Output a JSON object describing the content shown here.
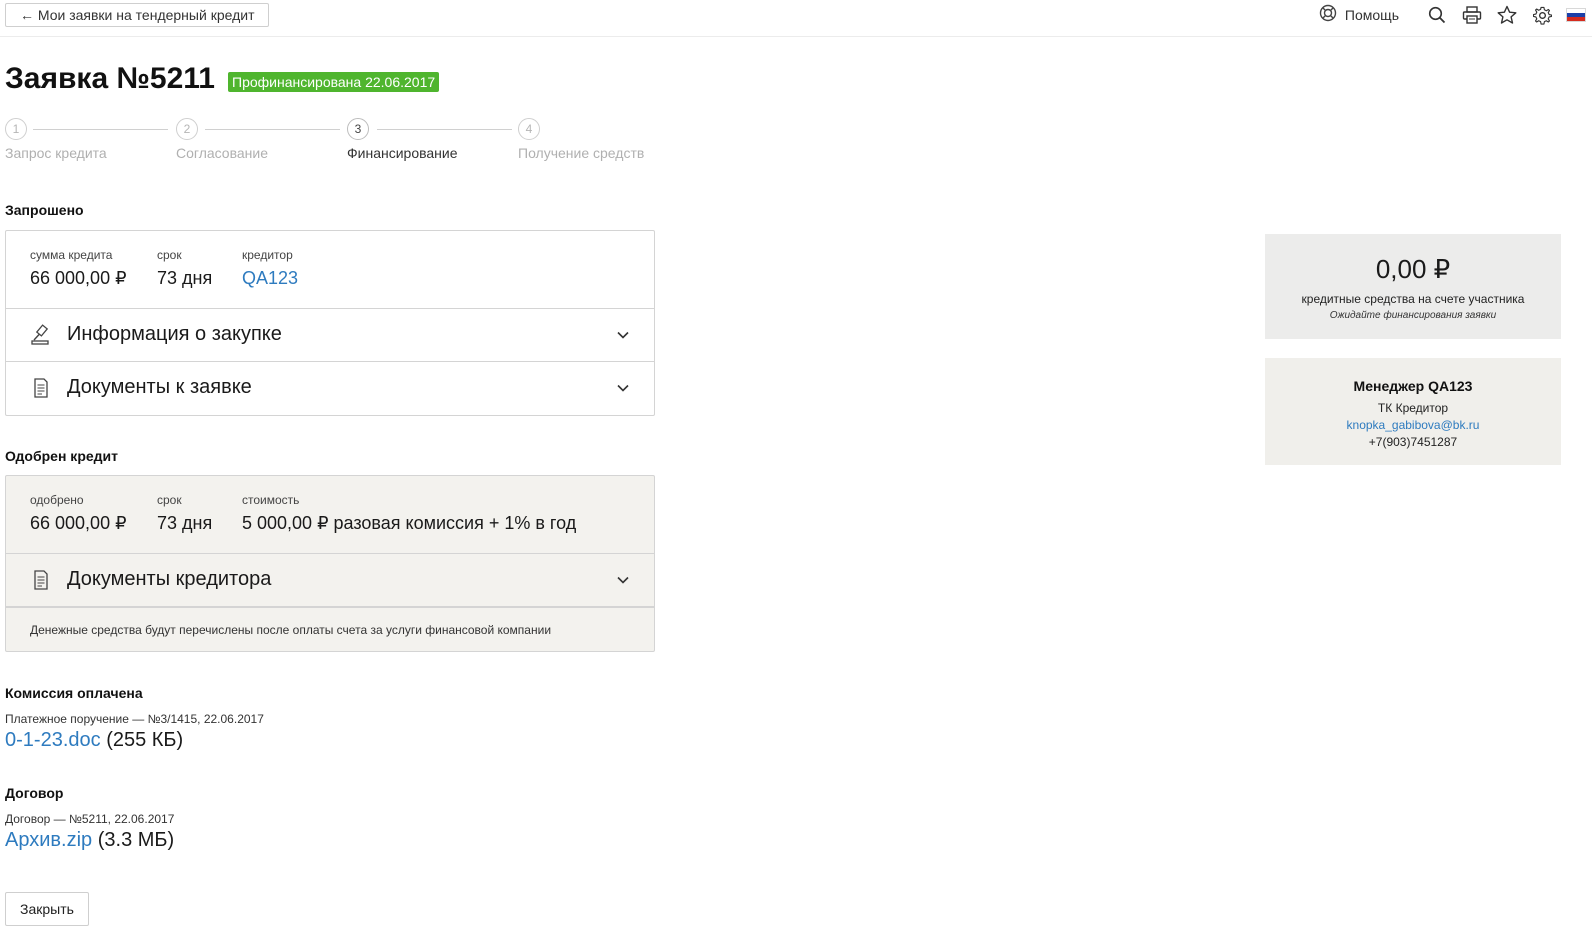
{
  "header": {
    "back_label": "← Мои заявки на тендерный кредит",
    "help_label": "Помощь",
    "icons": [
      "lifebuoy-icon",
      "search-icon",
      "printer-icon",
      "star-icon",
      "gear-icon",
      "russian-flag-icon"
    ],
    "flag_colors": [
      "#ffffff",
      "#1c3fa8",
      "#d52b1e"
    ]
  },
  "page": {
    "title": "Заявка №5211",
    "status": "Профинансирована 22.06.2017",
    "status_color": "#4fb52e"
  },
  "steps": [
    {
      "num": "1",
      "label": "Запрос кредита",
      "active": false
    },
    {
      "num": "2",
      "label": "Согласование",
      "active": false
    },
    {
      "num": "3",
      "label": "Финансирование",
      "active": true
    },
    {
      "num": "4",
      "label": "Получение средств",
      "active": false
    }
  ],
  "requested": {
    "heading": "Запрошено",
    "amount_label": "сумма кредита",
    "amount": "66 000,00 ₽",
    "term_label": "срок",
    "term": "73 дня",
    "creditor_label": "кредитор",
    "creditor": "QA123",
    "purchase_info": "Информация о закупке",
    "documents": "Документы к заявке"
  },
  "approved": {
    "heading": "Одобрен кредит",
    "approved_label": "одобрено",
    "approved_value": "66 000,00 ₽",
    "term_label": "срок",
    "term": "73 дня",
    "cost_label": "стоимость",
    "cost": "5 000,00 ₽ разовая комиссия + 1% в год",
    "creditor_docs": "Документы кредитора",
    "note": "Денежные средства будут перечислены после оплаты счета за услуги финансовой компании"
  },
  "commission": {
    "heading": "Комиссия оплачена",
    "order": "Платежное поручение — №3/1415, 22.06.2017",
    "file_name": "0-1-23.doc",
    "file_size": "(255 КБ)"
  },
  "contract": {
    "heading": "Договор",
    "info": "Договор — №5211, 22.06.2017",
    "file_name": "Архив.zip",
    "file_size": "(3.3 МБ)"
  },
  "close_label": "Закрыть",
  "balance": {
    "amount": "0,00 ₽",
    "description": "кредитные средства на счете участника",
    "waiting": "Ожидайте финансирования заявки"
  },
  "manager": {
    "title": "Менеджер QA123",
    "company": "ТК Кредитор",
    "email": "knopka_gabibova@bk.ru",
    "phone": "+7(903)7451287"
  },
  "colors": {
    "link": "#2e7bbf",
    "card_gray": "#f3f2ee",
    "panel_gray": "#ececeb"
  }
}
